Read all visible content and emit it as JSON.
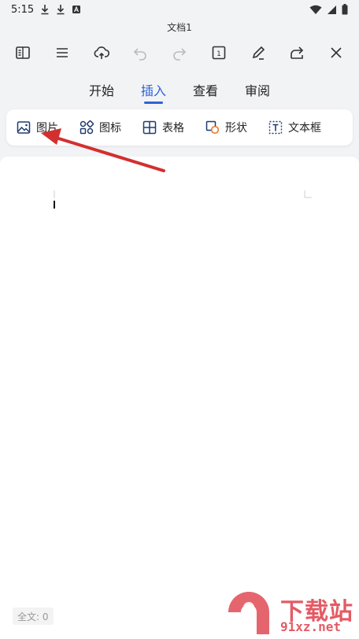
{
  "status": {
    "time": "5:15"
  },
  "document": {
    "title": "文档1"
  },
  "toolbar": {
    "buttons": [
      "sidebar-panel-icon",
      "menu-icon",
      "cloud-upload-icon",
      "undo-icon",
      "redo-icon",
      "page-count-icon",
      "pen-edit-icon",
      "share-icon",
      "close-icon"
    ],
    "page_number": "1"
  },
  "tabs": [
    {
      "label": "开始",
      "active": false
    },
    {
      "label": "插入",
      "active": true
    },
    {
      "label": "查看",
      "active": false
    },
    {
      "label": "审阅",
      "active": false
    }
  ],
  "insert_bar": {
    "items": [
      {
        "label": "图片",
        "icon": "image-icon"
      },
      {
        "label": "图标",
        "icon": "icons-icon"
      },
      {
        "label": "表格",
        "icon": "table-icon"
      },
      {
        "label": "形状",
        "icon": "shape-icon"
      },
      {
        "label": "文本框",
        "icon": "textbox-icon"
      }
    ]
  },
  "footer": {
    "word_count": "全文: 0"
  },
  "watermark": {
    "top": "下载站",
    "bottom": "91xz.net"
  },
  "colors": {
    "accent": "#2d63d6",
    "annotation_arrow": "#d32f2f",
    "watermark": "#e04a55"
  }
}
